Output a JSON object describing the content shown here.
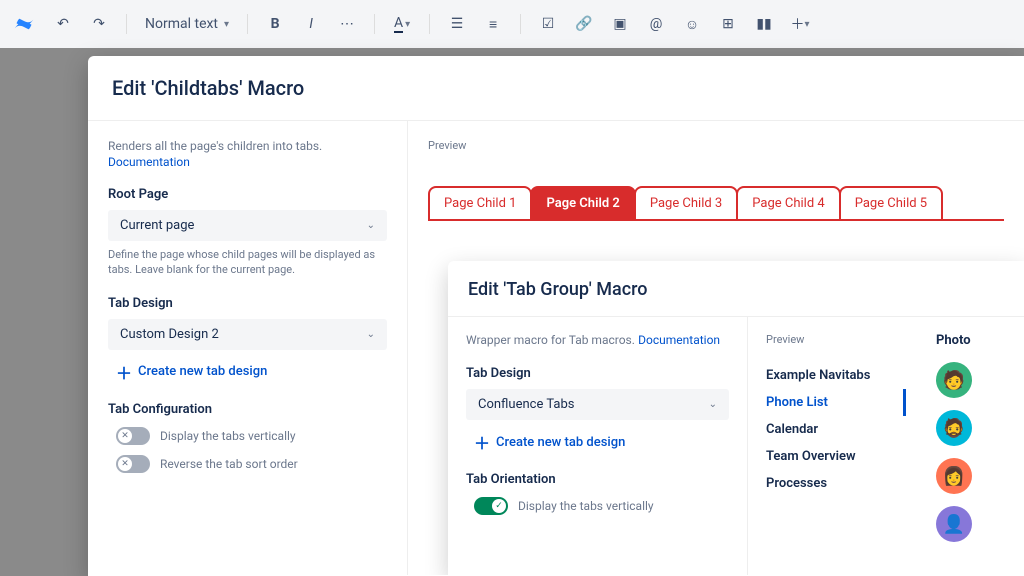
{
  "toolbar": {
    "text_style": "Normal text"
  },
  "modal": {
    "title": "Edit 'Childtabs' Macro",
    "description": "Renders all the page's children into tabs.",
    "doc_link": "Documentation",
    "root_page": {
      "label": "Root Page",
      "value": "Current page",
      "hint": "Define the page whose child pages will be displayed as tabs. Leave blank for the current page."
    },
    "tab_design": {
      "label": "Tab Design",
      "value": "Custom Design 2",
      "create_label": "Create new tab design"
    },
    "tab_config": {
      "label": "Tab Configuration",
      "vertical_label": "Display the tabs vertically",
      "reverse_label": "Reverse the tab sort order"
    }
  },
  "preview": {
    "label": "Preview",
    "tabs": [
      "Page Child 1",
      "Page Child 2",
      "Page Child 3",
      "Page Child 4",
      "Page Child 5"
    ],
    "active_index": 1
  },
  "inner_modal": {
    "title": "Edit 'Tab Group' Macro",
    "description": "Wrapper macro for Tab macros.",
    "doc_link": "Documentation",
    "tab_design": {
      "label": "Tab Design",
      "value": "Confluence Tabs",
      "create_label": "Create new tab design"
    },
    "orientation": {
      "label": "Tab Orientation",
      "vertical_label": "Display the tabs vertically"
    },
    "preview": {
      "label": "Preview",
      "tabs": [
        "Example Navitabs",
        "Phone List",
        "Calendar",
        "Team Overview",
        "Processes"
      ],
      "active_index": 1,
      "column_header": "Photo"
    }
  }
}
